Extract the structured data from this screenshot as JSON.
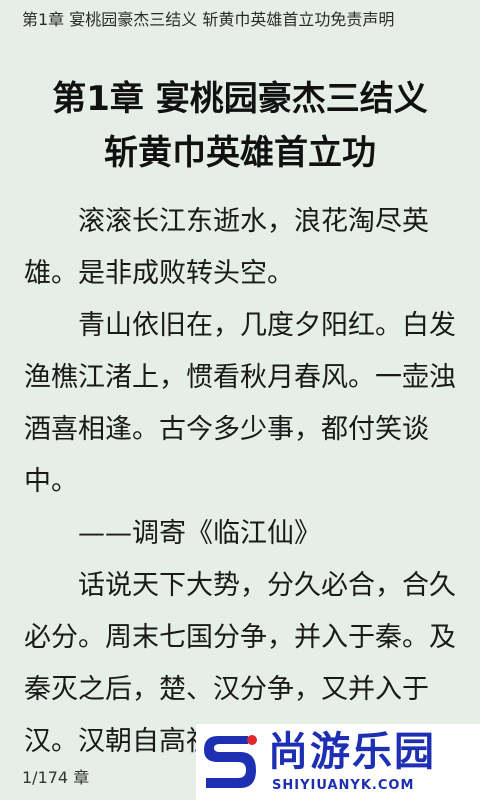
{
  "header": {
    "running_title": "第1章 宴桃园豪杰三结义 斩黄巾英雄首立功免责声明"
  },
  "chapter": {
    "title_line1": "第1章 宴桃园豪杰三结义",
    "title_line2": "斩黄巾英雄首立功"
  },
  "body": {
    "paragraphs": [
      "滚滚长江东逝水，浪花淘尽英雄。是非成败转头空。",
      "青山依旧在，几度夕阳红。白发渔樵江渚上，惯看秋月春风。一壶浊酒喜相逢。古今多少事，都付笑谈中。",
      "——调寄《临江仙》",
      "话说天下大势，分久必合，合久必分。周末七国分争，并入于秦。及秦灭之后，楚、汉分争，又并入于汉。汉朝自高祖斩白"
    ]
  },
  "footer": {
    "page_indicator": "1/174 章"
  },
  "watermark": {
    "brand": "尚游乐园",
    "url": "SHIYIUANYK.COM",
    "logo_icon": "s-logo-icon",
    "colors": {
      "brand": "#1d2fb3",
      "accent": "#e0282e"
    }
  }
}
